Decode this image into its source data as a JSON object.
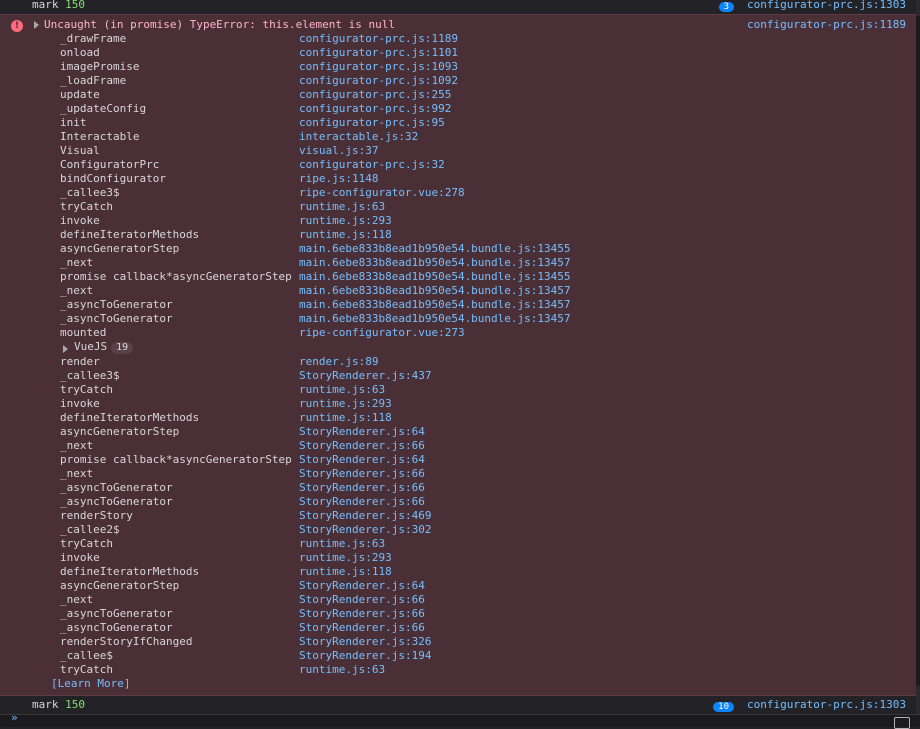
{
  "top_mark": {
    "label": "mark",
    "value": "150",
    "badge": "3",
    "source": "configurator-prc.js:1303"
  },
  "error": {
    "message": "Uncaught (in promise) TypeError: this.element is null",
    "source": "configurator-prc.js:1189",
    "frames_a": [
      {
        "fn": "_drawFrame",
        "loc": "configurator-prc.js:1189"
      },
      {
        "fn": "onload",
        "loc": "configurator-prc.js:1101"
      },
      {
        "fn": "imagePromise",
        "loc": "configurator-prc.js:1093"
      },
      {
        "fn": "_loadFrame",
        "loc": "configurator-prc.js:1092"
      },
      {
        "fn": "update",
        "loc": "configurator-prc.js:255"
      },
      {
        "fn": "_updateConfig",
        "loc": "configurator-prc.js:992"
      },
      {
        "fn": "init",
        "loc": "configurator-prc.js:95"
      },
      {
        "fn": "Interactable",
        "loc": "interactable.js:32"
      },
      {
        "fn": "Visual",
        "loc": "visual.js:37"
      },
      {
        "fn": "ConfiguratorPrc",
        "loc": "configurator-prc.js:32"
      },
      {
        "fn": "bindConfigurator",
        "loc": "ripe.js:1148"
      },
      {
        "fn": "_callee3$",
        "loc": "ripe-configurator.vue:278"
      },
      {
        "fn": "tryCatch",
        "loc": "runtime.js:63"
      },
      {
        "fn": "invoke",
        "loc": "runtime.js:293"
      },
      {
        "fn": "defineIteratorMethods",
        "loc": "runtime.js:118"
      },
      {
        "fn": "asyncGeneratorStep",
        "loc": "main.6ebe833b8ead1b950e54.bundle.js:13455"
      },
      {
        "fn": "_next",
        "loc": "main.6ebe833b8ead1b950e54.bundle.js:13457"
      },
      {
        "fn": "promise callback*asyncGeneratorStep",
        "loc": "main.6ebe833b8ead1b950e54.bundle.js:13455"
      },
      {
        "fn": "_next",
        "loc": "main.6ebe833b8ead1b950e54.bundle.js:13457"
      },
      {
        "fn": "_asyncToGenerator",
        "loc": "main.6ebe833b8ead1b950e54.bundle.js:13457"
      },
      {
        "fn": "_asyncToGenerator",
        "loc": "main.6ebe833b8ead1b950e54.bundle.js:13457"
      },
      {
        "fn": "mounted",
        "loc": "ripe-configurator.vue:273"
      }
    ],
    "group": {
      "label": "VueJS",
      "count": "19"
    },
    "frames_b": [
      {
        "fn": "render",
        "loc": "render.js:89"
      },
      {
        "fn": "_callee3$",
        "loc": "StoryRenderer.js:437"
      },
      {
        "fn": "tryCatch",
        "loc": "runtime.js:63"
      },
      {
        "fn": "invoke",
        "loc": "runtime.js:293"
      },
      {
        "fn": "defineIteratorMethods",
        "loc": "runtime.js:118"
      },
      {
        "fn": "asyncGeneratorStep",
        "loc": "StoryRenderer.js:64"
      },
      {
        "fn": "_next",
        "loc": "StoryRenderer.js:66"
      },
      {
        "fn": "promise callback*asyncGeneratorStep",
        "loc": "StoryRenderer.js:64"
      },
      {
        "fn": "_next",
        "loc": "StoryRenderer.js:66"
      },
      {
        "fn": "_asyncToGenerator",
        "loc": "StoryRenderer.js:66"
      },
      {
        "fn": "_asyncToGenerator",
        "loc": "StoryRenderer.js:66"
      },
      {
        "fn": "renderStory",
        "loc": "StoryRenderer.js:469"
      },
      {
        "fn": "_callee2$",
        "loc": "StoryRenderer.js:302"
      },
      {
        "fn": "tryCatch",
        "loc": "runtime.js:63"
      },
      {
        "fn": "invoke",
        "loc": "runtime.js:293"
      },
      {
        "fn": "defineIteratorMethods",
        "loc": "runtime.js:118"
      },
      {
        "fn": "asyncGeneratorStep",
        "loc": "StoryRenderer.js:64"
      },
      {
        "fn": "_next",
        "loc": "StoryRenderer.js:66"
      },
      {
        "fn": "_asyncToGenerator",
        "loc": "StoryRenderer.js:66"
      },
      {
        "fn": "_asyncToGenerator",
        "loc": "StoryRenderer.js:66"
      },
      {
        "fn": "renderStoryIfChanged",
        "loc": "StoryRenderer.js:326"
      },
      {
        "fn": "_callee$",
        "loc": "StoryRenderer.js:194"
      },
      {
        "fn": "tryCatch",
        "loc": "runtime.js:63"
      }
    ],
    "learn_more": "[Learn More]"
  },
  "bottom_mark": {
    "label": "mark",
    "value": "150",
    "badge": "10",
    "source": "configurator-prc.js:1303"
  },
  "prompt": "»"
}
